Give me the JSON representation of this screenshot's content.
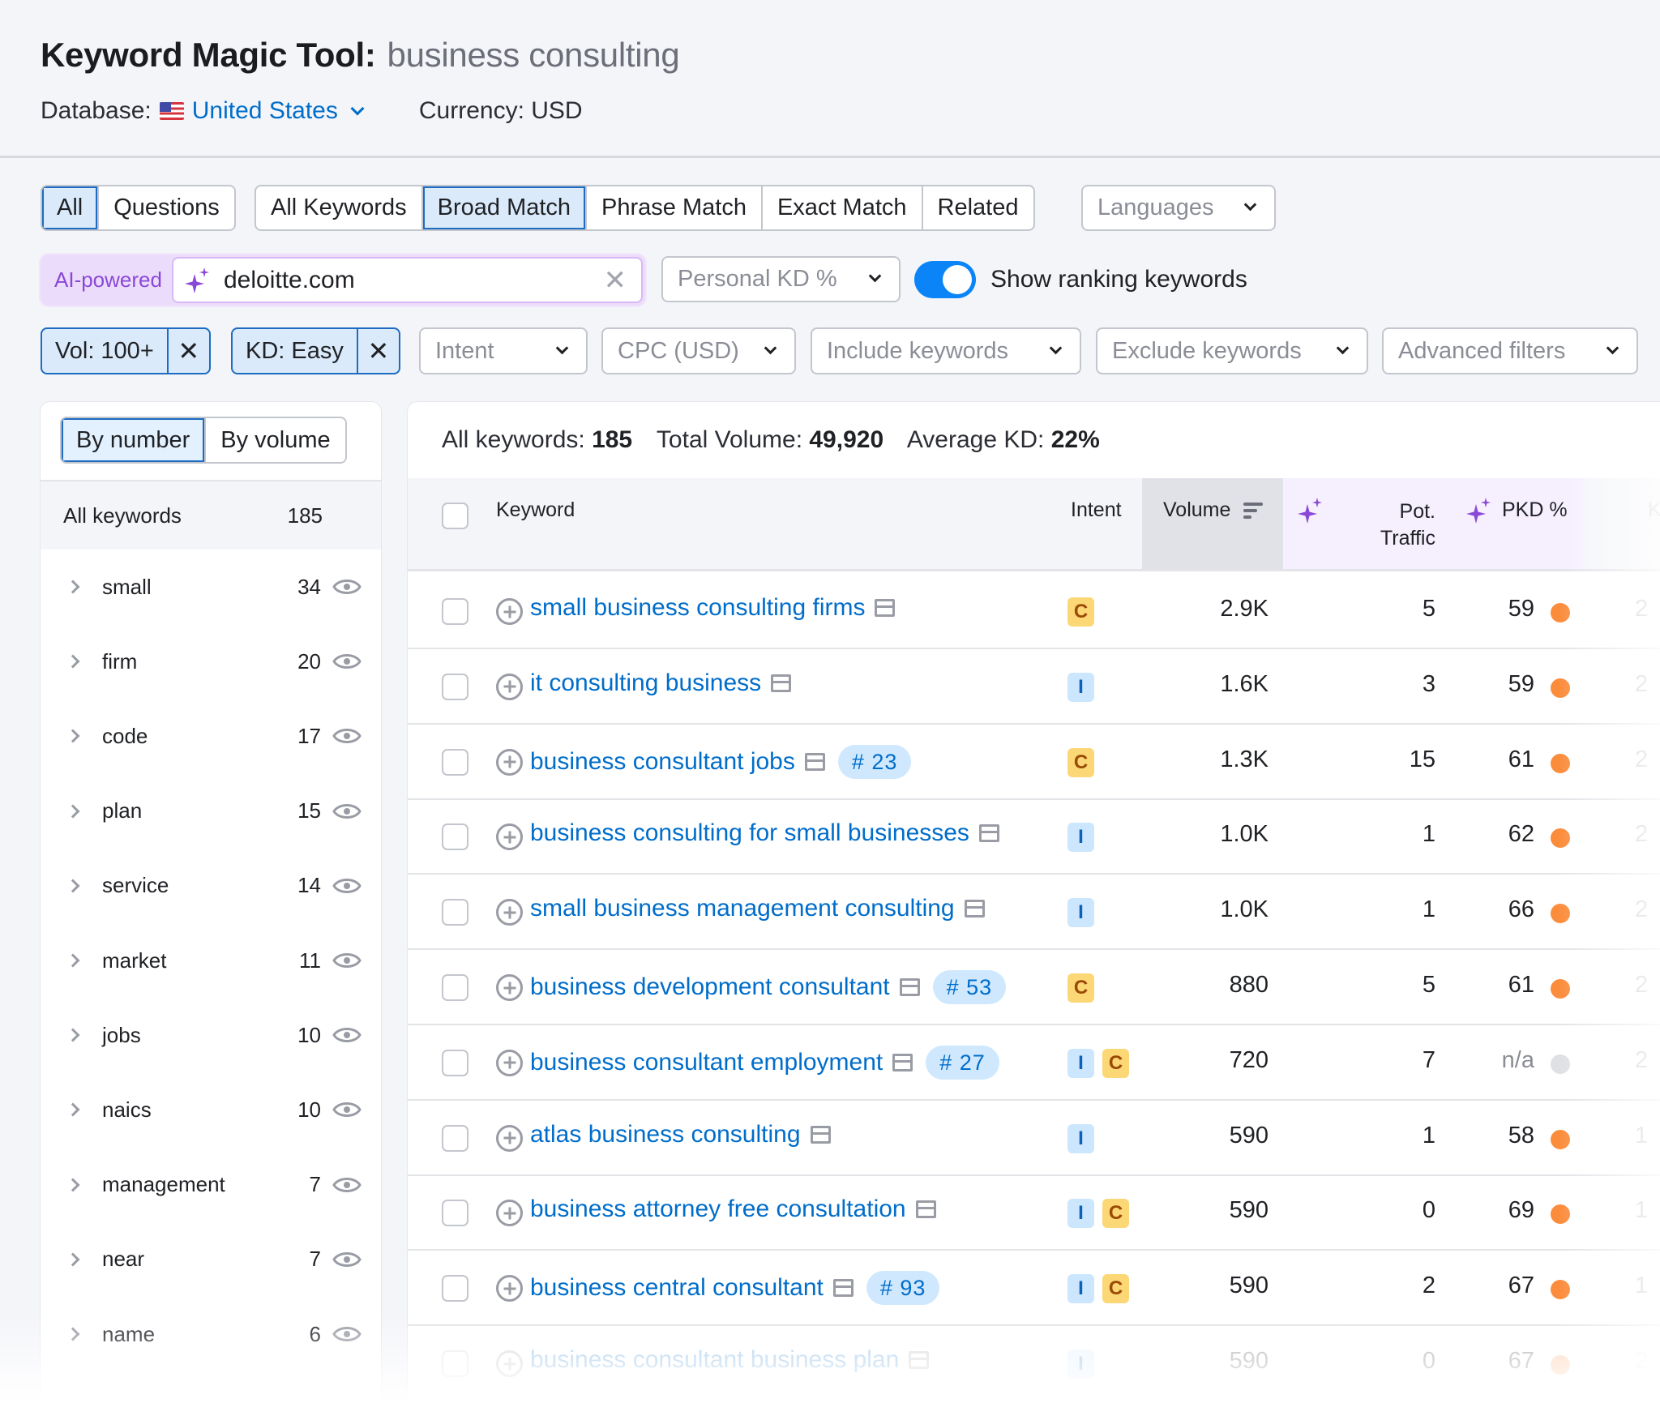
{
  "header": {
    "title": "Keyword Magic Tool:",
    "query": "business consulting",
    "database_label": "Database:",
    "database_value": "United States",
    "currency": "Currency: USD"
  },
  "tabs": {
    "question_filter": [
      {
        "label": "All",
        "active": true
      },
      {
        "label": "Questions",
        "active": false
      }
    ],
    "match_type": [
      {
        "label": "All Keywords",
        "active": false
      },
      {
        "label": "Broad Match",
        "active": true
      },
      {
        "label": "Phrase Match",
        "active": false
      },
      {
        "label": "Exact Match",
        "active": false
      },
      {
        "label": "Related",
        "active": false
      }
    ],
    "languages": "Languages"
  },
  "ai": {
    "label": "AI-powered",
    "domain_value": "deloitte.com",
    "clear": "✕",
    "personal_kd": "Personal KD %",
    "toggle_on": true,
    "toggle_label": "Show ranking keywords"
  },
  "filters": {
    "chips": [
      {
        "label": "Vol: 100+",
        "remove": "✕"
      },
      {
        "label": "KD: Easy",
        "remove": "✕"
      }
    ],
    "dropdowns": [
      "Intent",
      "CPC (USD)",
      "Include keywords",
      "Exclude keywords",
      "Advanced filters"
    ]
  },
  "sidebar": {
    "sort_options": [
      {
        "label": "By number",
        "active": true
      },
      {
        "label": "By volume",
        "active": false
      }
    ],
    "all_label": "All keywords",
    "all_count": "185",
    "groups": [
      {
        "label": "small",
        "count": "34"
      },
      {
        "label": "firm",
        "count": "20"
      },
      {
        "label": "code",
        "count": "17"
      },
      {
        "label": "plan",
        "count": "15"
      },
      {
        "label": "service",
        "count": "14"
      },
      {
        "label": "market",
        "count": "11"
      },
      {
        "label": "jobs",
        "count": "10"
      },
      {
        "label": "naics",
        "count": "10"
      },
      {
        "label": "management",
        "count": "7"
      },
      {
        "label": "near",
        "count": "7"
      },
      {
        "label": "name",
        "count": "6"
      }
    ]
  },
  "summary": {
    "all_keywords_label": "All keywords:",
    "all_keywords_value": "185",
    "total_volume_label": "Total Volume:",
    "total_volume_value": "49,920",
    "avg_kd_label": "Average KD:",
    "avg_kd_value": "22%"
  },
  "table": {
    "columns": {
      "keyword": "Keyword",
      "intent": "Intent",
      "volume": "Volume",
      "pot_traffic_1": "Pot.",
      "pot_traffic_2": "Traffic",
      "pkd": "PKD %",
      "kd_cut": "K"
    },
    "colors": {
      "dot_orange": "#fb8c3c",
      "dot_na": "#dfe0e4"
    },
    "rows": [
      {
        "keyword": "small business consulting firms",
        "rank": "",
        "intents": [
          "C"
        ],
        "volume": "2.9K",
        "pot_traffic": "5",
        "pkd": "59",
        "pkd_level": "orange",
        "kd_cut": "2"
      },
      {
        "keyword": "it consulting business",
        "rank": "",
        "intents": [
          "I"
        ],
        "volume": "1.6K",
        "pot_traffic": "3",
        "pkd": "59",
        "pkd_level": "orange",
        "kd_cut": "2"
      },
      {
        "keyword": "business consultant jobs",
        "rank": "# 23",
        "intents": [
          "C"
        ],
        "volume": "1.3K",
        "pot_traffic": "15",
        "pkd": "61",
        "pkd_level": "orange",
        "kd_cut": "2"
      },
      {
        "keyword": "business consulting for small businesses",
        "rank": "",
        "intents": [
          "I"
        ],
        "volume": "1.0K",
        "pot_traffic": "1",
        "pkd": "62",
        "pkd_level": "orange",
        "kd_cut": "2"
      },
      {
        "keyword": "small business management consulting",
        "rank": "",
        "intents": [
          "I"
        ],
        "volume": "1.0K",
        "pot_traffic": "1",
        "pkd": "66",
        "pkd_level": "orange",
        "kd_cut": "2"
      },
      {
        "keyword": "business development consultant",
        "rank": "# 53",
        "intents": [
          "C"
        ],
        "volume": "880",
        "pot_traffic": "5",
        "pkd": "61",
        "pkd_level": "orange",
        "kd_cut": "2"
      },
      {
        "keyword": "business consultant employment",
        "rank": "# 27",
        "intents": [
          "I",
          "C"
        ],
        "volume": "720",
        "pot_traffic": "7",
        "pkd": "n/a",
        "pkd_level": "na",
        "kd_cut": "2"
      },
      {
        "keyword": "atlas business consulting",
        "rank": "",
        "intents": [
          "I"
        ],
        "volume": "590",
        "pot_traffic": "1",
        "pkd": "58",
        "pkd_level": "orange",
        "kd_cut": "1"
      },
      {
        "keyword": "business attorney free consultation",
        "rank": "",
        "intents": [
          "I",
          "C"
        ],
        "volume": "590",
        "pot_traffic": "0",
        "pkd": "69",
        "pkd_level": "orange",
        "kd_cut": "1"
      },
      {
        "keyword": "business central consultant",
        "rank": "# 93",
        "intents": [
          "I",
          "C"
        ],
        "volume": "590",
        "pot_traffic": "2",
        "pkd": "67",
        "pkd_level": "orange",
        "kd_cut": "1"
      },
      {
        "keyword": "business consultant business plan",
        "rank": "",
        "intents": [
          "I"
        ],
        "volume": "590",
        "pot_traffic": "0",
        "pkd": "67",
        "pkd_level": "orange",
        "kd_cut": "2"
      }
    ]
  }
}
